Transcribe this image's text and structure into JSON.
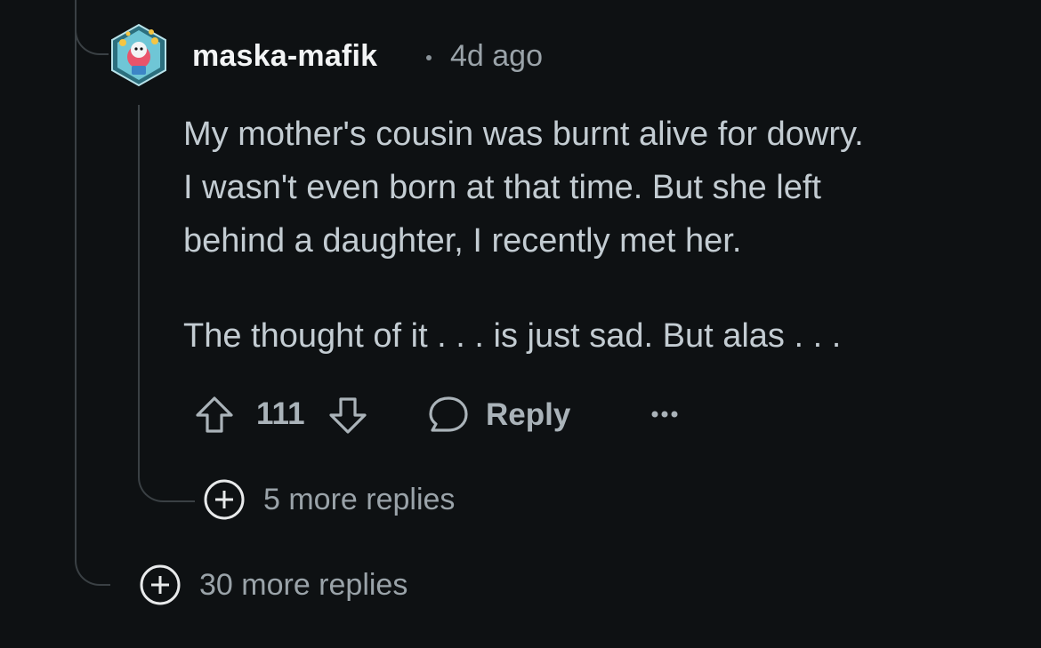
{
  "comment": {
    "username": "maska-mafik",
    "timestamp": "4d ago",
    "avatar_icon": "snoo-avatar-icon",
    "paragraphs": [
      "My mother's cousin was burnt alive for dowry.\nI wasn't even born at that time. But she left\nbehind a daughter, I recently met her.",
      "The thought of it . . . is just sad. But alas . . ."
    ],
    "vote_count": "111",
    "reply_label": "Reply",
    "more_options_icon": "ellipsis-icon"
  },
  "nested_replies": {
    "label": "5 more replies"
  },
  "thread_replies": {
    "label": "30 more replies"
  },
  "colors": {
    "background": "#0e1113",
    "text": "#c3ccd2",
    "username": "#f2f4f5",
    "muted": "#9aa3a9",
    "thread_line": "#3a4044"
  }
}
